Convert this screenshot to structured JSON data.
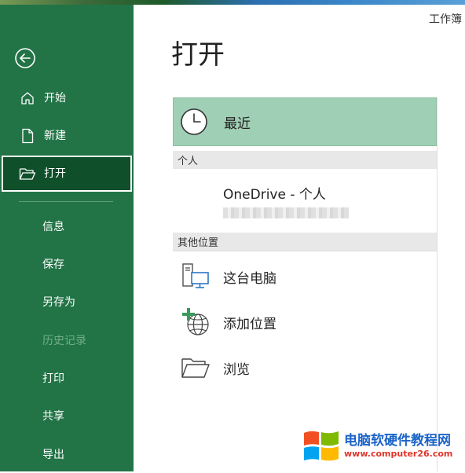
{
  "window": {
    "title": "工作簿"
  },
  "sidebar": {
    "back_label": "",
    "items": [
      {
        "label": "开始",
        "icon": "home-icon"
      },
      {
        "label": "新建",
        "icon": "new-document-icon"
      },
      {
        "label": "打开",
        "icon": "open-folder-icon",
        "active": true
      },
      {
        "label": "信息"
      },
      {
        "label": "保存"
      },
      {
        "label": "另存为"
      },
      {
        "label": "历史记录",
        "disabled": true
      },
      {
        "label": "打印"
      },
      {
        "label": "共享"
      },
      {
        "label": "导出"
      }
    ]
  },
  "main": {
    "title": "打开",
    "recent": {
      "label": "最近",
      "icon": "clock-icon"
    },
    "personal": {
      "header": "个人",
      "onedrive_label": "OneDrive - 个人"
    },
    "other": {
      "header": "其他位置",
      "items": [
        {
          "label": "这台电脑",
          "icon": "this-pc-icon"
        },
        {
          "label": "添加位置",
          "icon": "add-location-icon"
        },
        {
          "label": "浏览",
          "icon": "browse-folder-icon"
        }
      ]
    }
  },
  "watermark": {
    "title": "电脑软硬件教程网",
    "url": "www.computer26.com"
  },
  "colors": {
    "sidebar": "#227447",
    "sidebar_active": "#0f4f2a",
    "recent_highlight": "#9fcfb4",
    "section_header": "#e8e8e8"
  }
}
